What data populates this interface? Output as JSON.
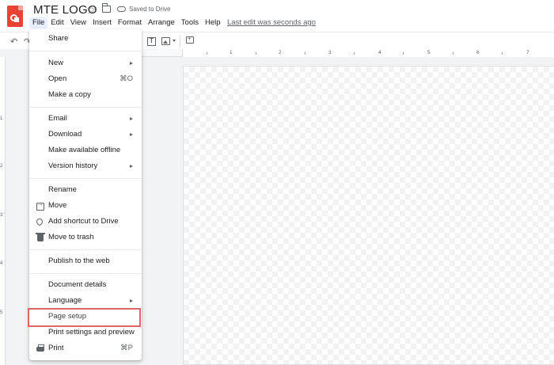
{
  "header": {
    "title": "MTE LOGO",
    "saved_status": "Saved to Drive",
    "last_edit": "Last edit was seconds ago"
  },
  "menubar": [
    "File",
    "Edit",
    "View",
    "Insert",
    "Format",
    "Arrange",
    "Tools",
    "Help"
  ],
  "ruler": {
    "horizontal": [
      "1",
      "2",
      "3",
      "4",
      "5",
      "6",
      "7"
    ],
    "vertical": [
      "1",
      "2",
      "3",
      "4",
      "5"
    ]
  },
  "file_menu": {
    "share": "Share",
    "new": "New",
    "open": "Open",
    "open_shortcut": "⌘O",
    "make_copy": "Make a copy",
    "email": "Email",
    "download": "Download",
    "make_offline": "Make available offline",
    "version_history": "Version history",
    "rename": "Rename",
    "move": "Move",
    "add_shortcut": "Add shortcut to Drive",
    "move_to_trash": "Move to trash",
    "publish": "Publish to the web",
    "document_details": "Document details",
    "language": "Language",
    "page_setup": "Page setup",
    "print_settings": "Print settings and preview",
    "print": "Print",
    "print_shortcut": "⌘P"
  },
  "colors": {
    "accent": "#1a73e8",
    "app_icon": "#ea4335",
    "highlight_box": "#e06666"
  }
}
